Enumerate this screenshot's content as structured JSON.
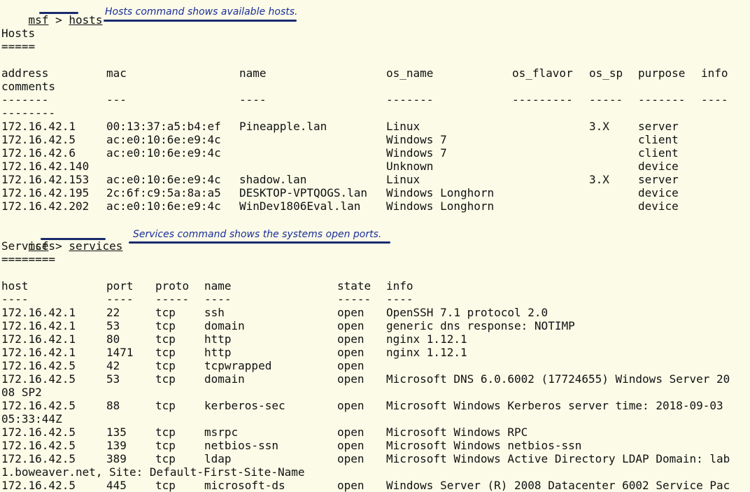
{
  "prompt": "msf",
  "prompt_sep": " > ",
  "hosts_cmd": "hosts",
  "hosts_note": "Hosts command shows available hosts.",
  "hosts_title": "Hosts",
  "hosts_title_rule": "=====",
  "hosts_headers": [
    "address",
    "mac",
    "name",
    "os_name",
    "os_flavor",
    "os_sp",
    "purpose",
    "info"
  ],
  "hosts_header_wrap": "comments",
  "hosts_dashes": [
    "-------",
    "---",
    "----",
    "-------",
    "---------",
    "-----",
    "-------",
    "----"
  ],
  "hosts_dash_wrap": "--------",
  "hosts_rows": [
    [
      "172.16.42.1",
      "00:13:37:a5:b4:ef",
      "Pineapple.lan",
      "Linux",
      "",
      "3.X",
      "server",
      ""
    ],
    [
      "172.16.42.5",
      "ac:e0:10:6e:e9:4c",
      "",
      "Windows 7",
      "",
      "",
      "client",
      ""
    ],
    [
      "172.16.42.6",
      "ac:e0:10:6e:e9:4c",
      "",
      "Windows 7",
      "",
      "",
      "client",
      ""
    ],
    [
      "172.16.42.140",
      "",
      "",
      "Unknown",
      "",
      "",
      "device",
      ""
    ],
    [
      "172.16.42.153",
      "ac:e0:10:6e:e9:4c",
      "shadow.lan",
      "Linux",
      "",
      "3.X",
      "server",
      ""
    ],
    [
      "172.16.42.195",
      "2c:6f:c9:5a:8a:a5",
      "DESKTOP-VPTQOGS.lan",
      "Windows Longhorn",
      "",
      "",
      "device",
      ""
    ],
    [
      "172.16.42.202",
      "ac:e0:10:6e:e9:4c",
      "WinDev1806Eval.lan",
      "Windows Longhorn",
      "",
      "",
      "device",
      ""
    ]
  ],
  "services_cmd": "services",
  "services_note": "Services command shows the systems open ports.",
  "services_title": "Services",
  "services_title_rule": "========",
  "services_headers": [
    "host",
    "port",
    "proto",
    "name",
    "state",
    "info"
  ],
  "services_dashes": [
    "----",
    "----",
    "-----",
    "----",
    "-----",
    "----"
  ],
  "services_rows": [
    {
      "cells": [
        "172.16.42.1",
        "22",
        "tcp",
        "ssh",
        "open",
        "OpenSSH 7.1 protocol 2.0"
      ],
      "wrap": ""
    },
    {
      "cells": [
        "172.16.42.1",
        "53",
        "tcp",
        "domain",
        "open",
        "generic dns response: NOTIMP"
      ],
      "wrap": ""
    },
    {
      "cells": [
        "172.16.42.1",
        "80",
        "tcp",
        "http",
        "open",
        "nginx 1.12.1"
      ],
      "wrap": ""
    },
    {
      "cells": [
        "172.16.42.1",
        "1471",
        "tcp",
        "http",
        "open",
        "nginx 1.12.1"
      ],
      "wrap": ""
    },
    {
      "cells": [
        "172.16.42.5",
        "42",
        "tcp",
        "tcpwrapped",
        "open",
        ""
      ],
      "wrap": ""
    },
    {
      "cells": [
        "172.16.42.5",
        "53",
        "tcp",
        "domain",
        "open",
        "Microsoft DNS 6.0.6002 (17724655) Windows Server 20"
      ],
      "wrap": "08 SP2"
    },
    {
      "cells": [
        "172.16.42.5",
        "88",
        "tcp",
        "kerberos-sec",
        "open",
        "Microsoft Windows Kerberos server time: 2018-09-03"
      ],
      "wrap": "05:33:44Z"
    },
    {
      "cells": [
        "172.16.42.5",
        "135",
        "tcp",
        "msrpc",
        "open",
        "Microsoft Windows RPC"
      ],
      "wrap": ""
    },
    {
      "cells": [
        "172.16.42.5",
        "139",
        "tcp",
        "netbios-ssn",
        "open",
        "Microsoft Windows netbios-ssn"
      ],
      "wrap": ""
    },
    {
      "cells": [
        "172.16.42.5",
        "389",
        "tcp",
        "ldap",
        "open",
        "Microsoft Windows Active Directory LDAP Domain: lab"
      ],
      "wrap": "1.boweaver.net, Site: Default-First-Site-Name"
    },
    {
      "cells": [
        "172.16.42.5",
        "445",
        "tcp",
        "microsoft-ds",
        "open",
        "Windows Server (R) 2008 Datacenter 6002 Service Pac"
      ],
      "wrap": ""
    }
  ]
}
